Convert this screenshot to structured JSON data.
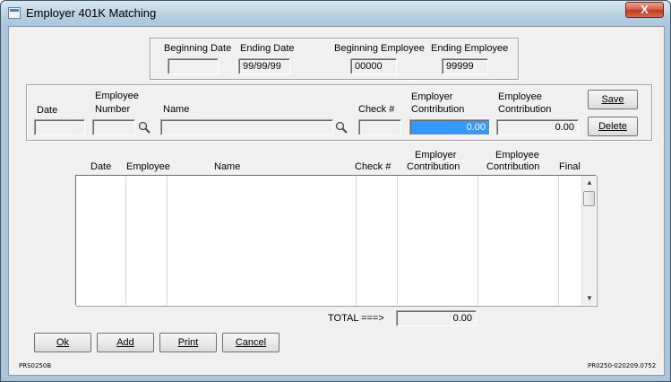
{
  "window": {
    "title": "Employer 401K Matching",
    "close_glyph": "X"
  },
  "filter": {
    "beginning_date_label": "Beginning Date",
    "beginning_date_value": "",
    "ending_date_label": "Ending Date",
    "ending_date_value": "99/99/99",
    "beginning_employee_label": "Beginning Employee",
    "beginning_employee_value": "00000",
    "ending_employee_label": "Ending Employee",
    "ending_employee_value": "99999"
  },
  "entry": {
    "date_label": "Date",
    "date_value": "",
    "employee_number_label_1": "Employee",
    "employee_number_label_2": "Number",
    "employee_number_value": "",
    "name_label": "Name",
    "name_value": "",
    "check_label": "Check #",
    "check_value": "",
    "employer_contribution_label_1": "Employer",
    "employer_contribution_label_2": "Contribution",
    "employer_contribution_value": "0.00",
    "employee_contribution_label_1": "Employee",
    "employee_contribution_label_2": "Contribution",
    "employee_contribution_value": "0.00",
    "save_label": "Save",
    "delete_label": "Delete"
  },
  "grid": {
    "columns": [
      {
        "label": "Date"
      },
      {
        "label": "Employee"
      },
      {
        "label": "Name"
      },
      {
        "label": "Check #"
      },
      {
        "label_1": "Employer",
        "label_2": "Contribution"
      },
      {
        "label_1": "Employee",
        "label_2": "Contribution"
      },
      {
        "label": "Final"
      }
    ],
    "rows": []
  },
  "total": {
    "label": "TOTAL ===>",
    "value": "0.00"
  },
  "actions": {
    "ok_label": "Ok",
    "add_label": "Add",
    "print_label": "Print",
    "cancel_label": "Cancel"
  },
  "footer": {
    "left_code": "PRS0250B",
    "right_code": "PR0250-020209.0752"
  }
}
